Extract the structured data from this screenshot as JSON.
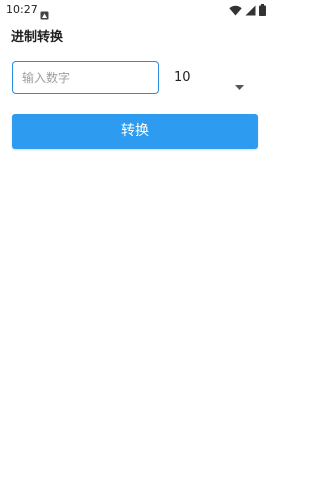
{
  "status_bar": {
    "time": "10:27",
    "icons": [
      "notification-icon",
      "wifi-icon",
      "signal-icon",
      "battery-icon"
    ]
  },
  "page": {
    "title": "进制转换"
  },
  "form": {
    "input_placeholder": "输入数字",
    "input_value": "",
    "base_selected": "10",
    "convert_label": "转换"
  },
  "colors": {
    "accent": "#2d9cf0",
    "input_border": "#2e8ee0",
    "background": "#ffffff"
  }
}
